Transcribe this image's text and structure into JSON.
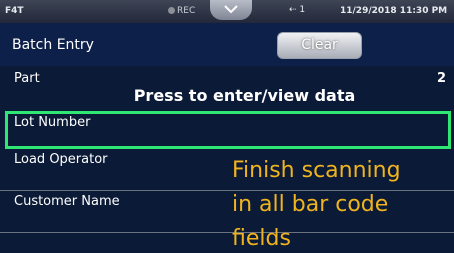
{
  "status": {
    "device": "F4T",
    "rec": "REC",
    "usb_count": "1",
    "datetime": "11/29/2018 11:30 PM"
  },
  "header": {
    "title": "Batch Entry",
    "clear_label": "Clear"
  },
  "rows": {
    "part": {
      "label": "Part",
      "count": "2",
      "prompt": "Press to enter/view data"
    },
    "lot": {
      "label": "Lot Number"
    },
    "operator": {
      "label": "Load Operator"
    },
    "customer": {
      "label": "Customer Name"
    }
  },
  "annotation": {
    "line1": "Finish scanning",
    "line2": "in all bar code",
    "line3": "fields"
  },
  "colors": {
    "highlight": "#2ee873",
    "annotation": "#f0b41e",
    "background": "#0b1a36"
  }
}
